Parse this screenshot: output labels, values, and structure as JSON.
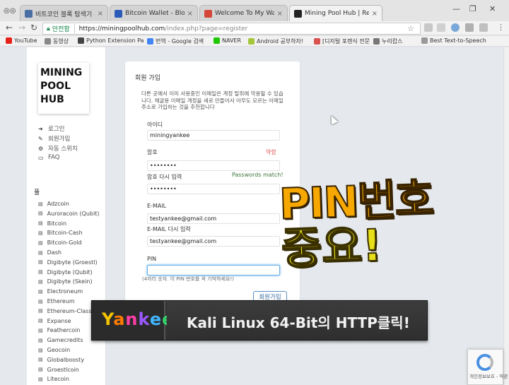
{
  "browser": {
    "tabs": [
      {
        "title": "비트코인 블록 탐색기 -",
        "fav": "#4a6fa5"
      },
      {
        "title": "Bitcoin Wallet - Blockc",
        "fav": "#2a5bb8"
      },
      {
        "title": "Welcome To My Wallet",
        "fav": "#d44638"
      },
      {
        "title": "Mining Pool Hub | Regis",
        "fav": "#222222"
      }
    ],
    "secure_label": "안전함",
    "url_host": "https://miningpoolhub.com",
    "url_path": "/index.php?page=register",
    "bookmarks": [
      {
        "label": "YouTube",
        "color": "#e62117"
      },
      {
        "label": "동영상",
        "color": "#888888"
      },
      {
        "label": "Python Extension Pa",
        "color": "#444444"
      },
      {
        "label": "번역 - Google 검색",
        "color": "#4285f4"
      },
      {
        "label": "NAVER",
        "color": "#1ec800"
      },
      {
        "label": "Android 공부하자!",
        "color": "#a4c639"
      },
      {
        "label": "[디지털 포렌식 전문",
        "color": "#d9534f"
      },
      {
        "label": "누리캅스",
        "color": "#777777"
      },
      {
        "label": "Best Text-to-Speech",
        "color": "#999999"
      }
    ]
  },
  "sidebar": {
    "logo": [
      "MINING",
      "POOL",
      "HUB"
    ],
    "nav": [
      {
        "icon": "login-icon",
        "glyph": "➜",
        "label": "로그인"
      },
      {
        "icon": "pencil-icon",
        "glyph": "✎",
        "label": "회원가입"
      },
      {
        "icon": "gear-icon",
        "glyph": "⚙",
        "label": "자동 스위치"
      },
      {
        "icon": "monitor-icon",
        "glyph": "▭",
        "label": "FAQ"
      }
    ],
    "coins_title": "풀",
    "coins": [
      "Adzcoin",
      "Auroracoin (Qubit)",
      "Bitcoin",
      "Bitcoin-Cash",
      "Bitcoin-Gold",
      "Dash",
      "Digibyte (Groestl)",
      "Digibyte (Qubit)",
      "Digibyte (Skein)",
      "Electroneum",
      "Ethereum",
      "Ethereum-Classic",
      "Expanse",
      "Feathercoin",
      "Gamecredits",
      "Geocoin",
      "Globalboosty",
      "Groestlcoin",
      "Litecoin"
    ]
  },
  "form": {
    "title": "회원 가입",
    "intro": "다른 곳에서 이미 사용중인 이메일은 계정 탈취에 악용될 수 있습니다. 채굴용 이메일 계정을 새로 만들어서 아무도 모르는 이메일 주소로 가입하는 것을 추천합니다",
    "id_label": "아이디",
    "id_value": "miningyankee",
    "pw_label": "암호",
    "pw_value": "••••••••",
    "pw_strength": "약함",
    "pw2_label": "암호 다시 입력",
    "pw2_value": "••••••••",
    "pw_match": "Passwords match!",
    "email_label": "E-MAIL",
    "email_value": "testyankee@gmail.com",
    "email2_label": "E-MAIL 다시 입력",
    "email2_value": "testyankee@gmail.com",
    "pin_label": "PIN",
    "pin_value": "",
    "pin_hint": "(4자리 숫자. 이 PIN 번호를 꼭 기억하세요!)",
    "submit_label": "회원가입"
  },
  "overlay": {
    "line1": "PIN번호",
    "line2": "중요!"
  },
  "banner": {
    "brand_letters": [
      "Y",
      "a",
      "n",
      "k",
      "e",
      "e"
    ],
    "message": "Kali Linux 64-Bit의 HTTP클릭!"
  },
  "recaptcha": {
    "text": "개인정보보호 - 약관"
  }
}
